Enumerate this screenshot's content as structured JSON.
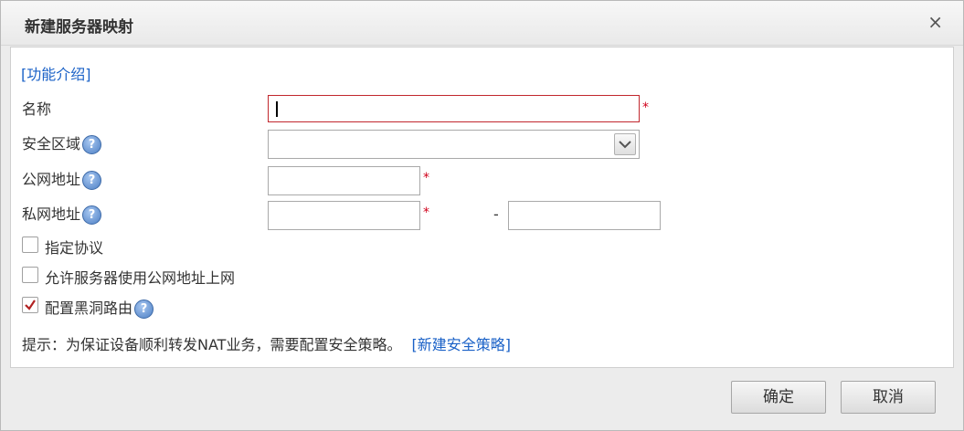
{
  "dialog": {
    "title": "新建服务器映射",
    "close_icon_glyph": "×"
  },
  "intro_link": "[功能介绍]",
  "form": {
    "name_label": "名称",
    "name_value": "",
    "required_mark": "*",
    "zone_label": "安全区域",
    "zone_value": "",
    "public_ip_label": "公网地址",
    "public_ip_value": "",
    "private_ip_label": "私网地址",
    "private_ip_start": "",
    "range_separator": "-",
    "private_ip_end": "",
    "help_glyph": "?"
  },
  "options": [
    {
      "label": "指定协议",
      "checked": false
    },
    {
      "label": "允许服务器使用公网地址上网",
      "checked": false
    },
    {
      "label": "配置黑洞路由",
      "checked": true
    }
  ],
  "hint": {
    "text": "提示：为保证设备顺利转发NAT业务，需要配置安全策略。",
    "link": "[新建安全策略]"
  },
  "buttons": {
    "ok": "确定",
    "cancel": "取消"
  },
  "colors": {
    "link": "#1a61c7",
    "required": "#d0021b",
    "error_border": "#c1272d",
    "check": "#b22222"
  }
}
